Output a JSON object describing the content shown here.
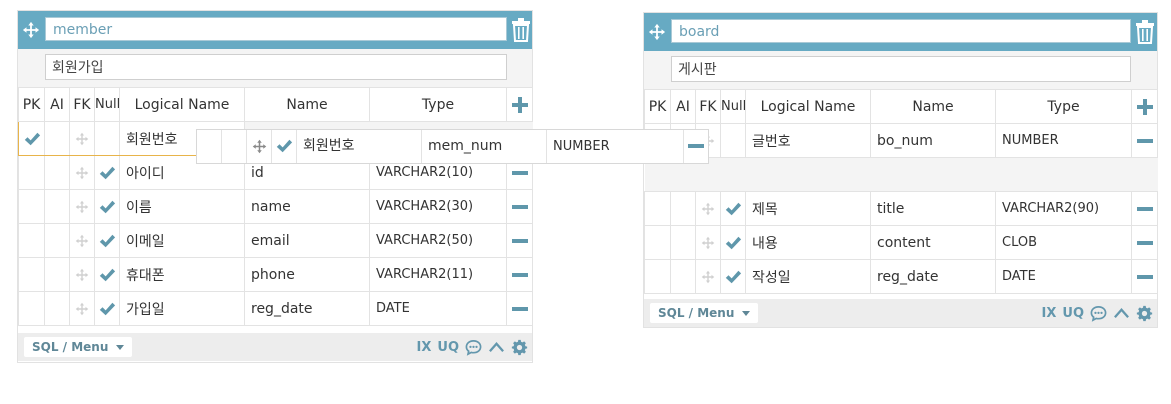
{
  "colors": {
    "header": "#67aac3",
    "accent": "#6397ad",
    "check": "#5f97ab",
    "selected_border": "#e8b44a"
  },
  "icons": {
    "move": "move-icon",
    "trash": "trash-icon",
    "check": "check-icon",
    "plus": "plus-icon",
    "minus": "minus-icon",
    "comment": "comment-icon",
    "chevron_up": "chevron-up-icon",
    "gear": "gear-icon"
  },
  "columns": {
    "pk": "PK",
    "ai": "AI",
    "fk": "FK",
    "null": "Null",
    "logical": "Logical Name",
    "name": "Name",
    "type": "Type"
  },
  "footer": {
    "sql_menu": "SQL / Menu",
    "ix": "IX",
    "uq": "UQ"
  },
  "member": {
    "name": "member",
    "comment": "회원가입",
    "rows": [
      {
        "pk": true,
        "fk": false,
        "notnull": false,
        "logical": "회원번호",
        "name": "",
        "type": ""
      },
      {
        "pk": false,
        "fk": false,
        "notnull": true,
        "logical": "아이디",
        "name": "id",
        "type": "VARCHAR2(10)"
      },
      {
        "pk": false,
        "fk": false,
        "notnull": true,
        "logical": "이름",
        "name": "name",
        "type": "VARCHAR2(30)"
      },
      {
        "pk": false,
        "fk": false,
        "notnull": true,
        "logical": "이메일",
        "name": "email",
        "type": "VARCHAR2(50)"
      },
      {
        "pk": false,
        "fk": false,
        "notnull": true,
        "logical": "휴대폰",
        "name": "phone",
        "type": "VARCHAR2(11)"
      },
      {
        "pk": false,
        "fk": false,
        "notnull": true,
        "logical": "가입일",
        "name": "reg_date",
        "type": "DATE"
      }
    ]
  },
  "dragging": {
    "logical": "회원번호",
    "name": "mem_num",
    "type": "NUMBER"
  },
  "board": {
    "name": "board",
    "comment": "게시판",
    "rows": [
      {
        "logical": "글번호",
        "name": "bo_num",
        "type": "NUMBER"
      },
      {
        "logical": "제목",
        "name": "title",
        "type": "VARCHAR2(90)"
      },
      {
        "logical": "내용",
        "name": "content",
        "type": "CLOB"
      },
      {
        "logical": "작성일",
        "name": "reg_date",
        "type": "DATE"
      }
    ]
  }
}
